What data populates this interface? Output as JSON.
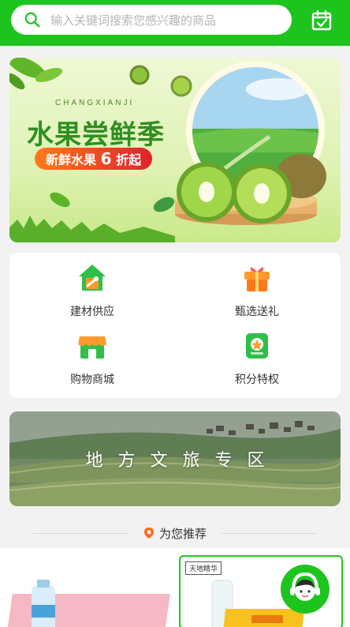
{
  "search": {
    "placeholder": "输入关键词搜索您感兴趣的商品",
    "icon": "search-icon"
  },
  "header": {
    "calendar_icon": "calendar-check-icon",
    "accent": "#1ec41e"
  },
  "banner": {
    "subtitle": "CHANGXIANJI",
    "title": "水果尝鲜季",
    "promo_prefix": "新鲜水果",
    "promo_number": "6",
    "promo_suffix": "折起"
  },
  "categories": [
    {
      "label": "建材供应",
      "icon": "house-wrench-icon"
    },
    {
      "label": "甄选送礼",
      "icon": "gift-icon"
    },
    {
      "label": "购物商城",
      "icon": "shop-icon"
    },
    {
      "label": "积分特权",
      "icon": "points-badge-icon"
    }
  ],
  "tourism": {
    "label": "地方文旅专区"
  },
  "recommend": {
    "title": "为您推荐"
  },
  "products": [
    {
      "brand": "天地精华"
    }
  ],
  "service": {
    "icon": "customer-service-icon"
  }
}
